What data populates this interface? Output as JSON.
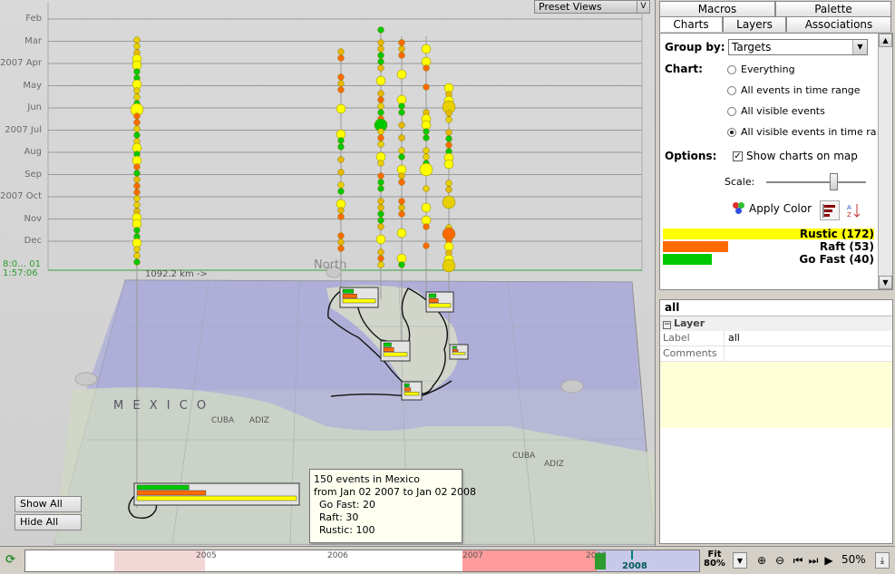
{
  "timeline": {
    "months": [
      {
        "label": "Feb"
      },
      {
        "label": "Mar"
      },
      {
        "label": "2007 Apr"
      },
      {
        "label": "May"
      },
      {
        "label": "Jun"
      },
      {
        "label": "2007 Jul"
      },
      {
        "label": "Aug"
      },
      {
        "label": "Sep"
      },
      {
        "label": "2007 Oct"
      },
      {
        "label": "Nov"
      },
      {
        "label": "Dec"
      }
    ],
    "current_time_line1": "8:0… 01",
    "current_time_line2": "1:57:06",
    "distance_label": "1092.2 km ->",
    "north_label": "North"
  },
  "preset_views": {
    "label": "Preset Views",
    "dropdown": "V"
  },
  "tooltip": {
    "title": "150 events in Mexico",
    "range": "from Jan 02 2007 to Jan 02 2008",
    "line1": "Go Fast: 20",
    "line2": "Raft: 30",
    "line3": "Rustic: 100"
  },
  "map_buttons": {
    "show_all": "Show All",
    "hide_all": "Hide All"
  },
  "map_labels": {
    "country": "M E X I C O",
    "cuba1": "CUBA",
    "adiz1": "ADIZ",
    "cuba2": "CUBA",
    "adiz2": "ADIZ"
  },
  "tabs": {
    "macros": "Macros",
    "palette": "Palette",
    "charts": "Charts",
    "layers": "Layers",
    "associations": "Associations"
  },
  "charts_panel": {
    "group_by_label": "Group by:",
    "group_by_value": "Targets",
    "chart_label": "Chart:",
    "radio_options": [
      "Everything",
      "All events in time range",
      "All visible events",
      "All visible events in time ra…"
    ],
    "selected_index": 3,
    "options_label": "Options:",
    "show_charts_label": "Show charts on map",
    "show_charts_checked": true,
    "scale_label": "Scale:",
    "scale_value": 0.68,
    "apply_color_label": "Apply Color"
  },
  "legend": [
    {
      "label": "Rustic (172)",
      "count": 172,
      "color": "#ffff00"
    },
    {
      "label": "Raft (53)",
      "count": 53,
      "color": "#ff6a00"
    },
    {
      "label": "Go Fast (40)",
      "count": 40,
      "color": "#00c800"
    }
  ],
  "layer_props": {
    "name": "all",
    "section": "Layer",
    "label_key": "Label",
    "label_value": "all",
    "comments_key": "Comments",
    "comments_value": ""
  },
  "time_bar": {
    "ticks": [
      "2005",
      "2006",
      "2007",
      "2008"
    ],
    "current_year": "2008",
    "fit_label": "Fit",
    "fit_value": "80%",
    "zoom": "50%"
  },
  "colors": {
    "rustic": "#ffff00",
    "raft": "#ff6a00",
    "go_fast": "#00c800",
    "panel": "#d4d0c8"
  }
}
